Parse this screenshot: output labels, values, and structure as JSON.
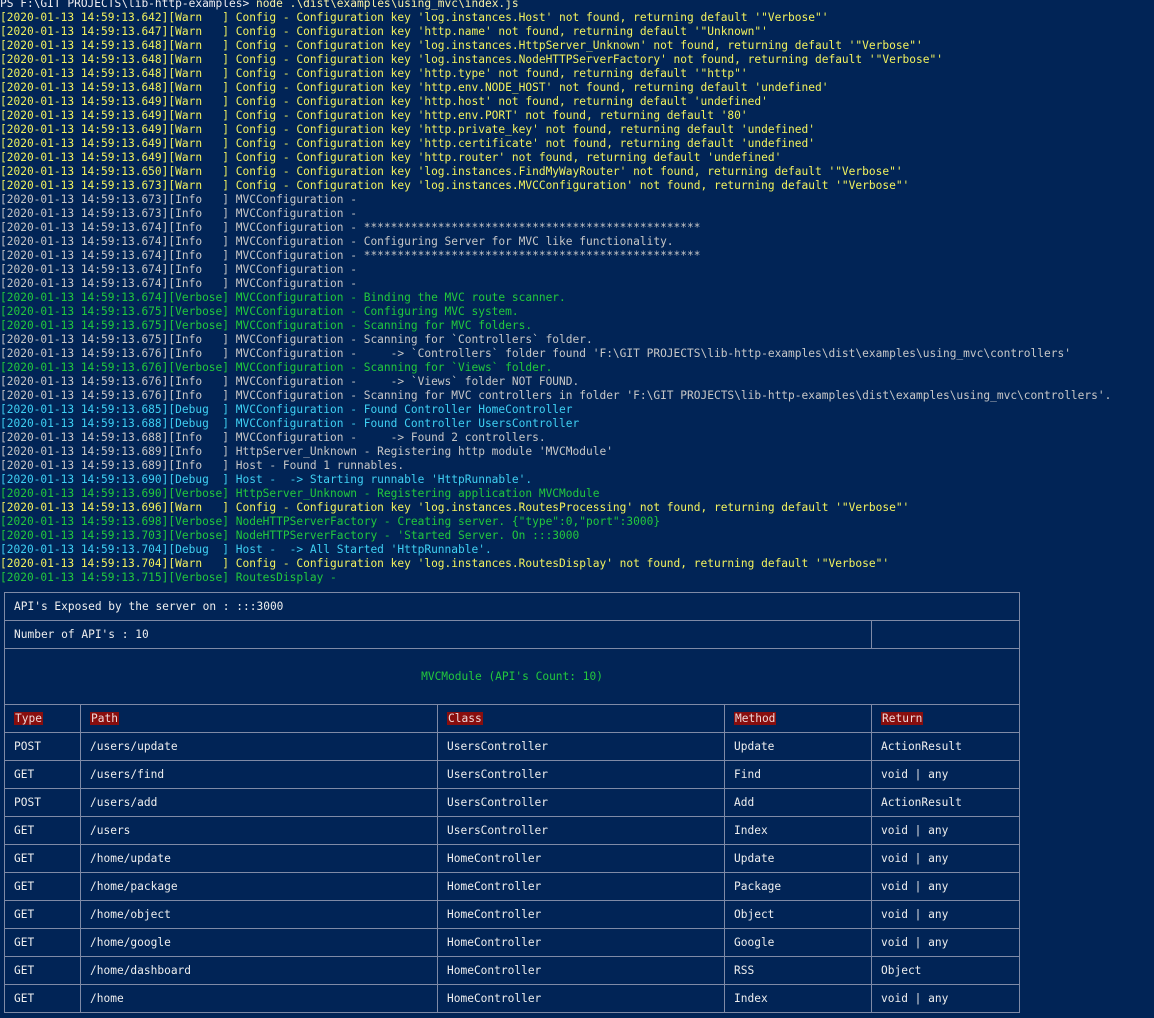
{
  "prompt": {
    "path": "PS F:\\GIT PROJECTS\\lib-http-examples> ",
    "command": "node .\\dist\\examples\\using_mvc\\index.js"
  },
  "log_lines": [
    {
      "level": "warn",
      "text": "[2020-01-13 14:59:13.642][Warn   ] Config - Configuration key 'log.instances.Host' not found, returning default '\"Verbose\"'"
    },
    {
      "level": "warn",
      "text": "[2020-01-13 14:59:13.647][Warn   ] Config - Configuration key 'http.name' not found, returning default '\"Unknown\"'"
    },
    {
      "level": "warn",
      "text": "[2020-01-13 14:59:13.648][Warn   ] Config - Configuration key 'log.instances.HttpServer_Unknown' not found, returning default '\"Verbose\"'"
    },
    {
      "level": "warn",
      "text": "[2020-01-13 14:59:13.648][Warn   ] Config - Configuration key 'log.instances.NodeHTTPServerFactory' not found, returning default '\"Verbose\"'"
    },
    {
      "level": "warn",
      "text": "[2020-01-13 14:59:13.648][Warn   ] Config - Configuration key 'http.type' not found, returning default '\"http\"'"
    },
    {
      "level": "warn",
      "text": "[2020-01-13 14:59:13.648][Warn   ] Config - Configuration key 'http.env.NODE_HOST' not found, returning default 'undefined'"
    },
    {
      "level": "warn",
      "text": "[2020-01-13 14:59:13.649][Warn   ] Config - Configuration key 'http.host' not found, returning default 'undefined'"
    },
    {
      "level": "warn",
      "text": "[2020-01-13 14:59:13.649][Warn   ] Config - Configuration key 'http.env.PORT' not found, returning default '80'"
    },
    {
      "level": "warn",
      "text": "[2020-01-13 14:59:13.649][Warn   ] Config - Configuration key 'http.private_key' not found, returning default 'undefined'"
    },
    {
      "level": "warn",
      "text": "[2020-01-13 14:59:13.649][Warn   ] Config - Configuration key 'http.certificate' not found, returning default 'undefined'"
    },
    {
      "level": "warn",
      "text": "[2020-01-13 14:59:13.649][Warn   ] Config - Configuration key 'http.router' not found, returning default 'undefined'"
    },
    {
      "level": "warn",
      "text": "[2020-01-13 14:59:13.650][Warn   ] Config - Configuration key 'log.instances.FindMyWayRouter' not found, returning default '\"Verbose\"'"
    },
    {
      "level": "warn",
      "text": "[2020-01-13 14:59:13.673][Warn   ] Config - Configuration key 'log.instances.MVCConfiguration' not found, returning default '\"Verbose\"'"
    },
    {
      "level": "info",
      "text": "[2020-01-13 14:59:13.673][Info   ] MVCConfiguration -"
    },
    {
      "level": "info",
      "text": "[2020-01-13 14:59:13.673][Info   ] MVCConfiguration -"
    },
    {
      "level": "info",
      "text": "[2020-01-13 14:59:13.674][Info   ] MVCConfiguration - **************************************************"
    },
    {
      "level": "info",
      "text": "[2020-01-13 14:59:13.674][Info   ] MVCConfiguration - Configuring Server for MVC like functionality."
    },
    {
      "level": "info",
      "text": "[2020-01-13 14:59:13.674][Info   ] MVCConfiguration - **************************************************"
    },
    {
      "level": "info",
      "text": "[2020-01-13 14:59:13.674][Info   ] MVCConfiguration -"
    },
    {
      "level": "info",
      "text": "[2020-01-13 14:59:13.674][Info   ] MVCConfiguration -"
    },
    {
      "level": "verbose",
      "text": "[2020-01-13 14:59:13.674][Verbose] MVCConfiguration - Binding the MVC route scanner."
    },
    {
      "level": "verbose",
      "text": "[2020-01-13 14:59:13.675][Verbose] MVCConfiguration - Configuring MVC system."
    },
    {
      "level": "verbose",
      "text": "[2020-01-13 14:59:13.675][Verbose] MVCConfiguration - Scanning for MVC folders."
    },
    {
      "level": "info",
      "text": "[2020-01-13 14:59:13.675][Info   ] MVCConfiguration - Scanning for `Controllers` folder."
    },
    {
      "level": "info",
      "text": "[2020-01-13 14:59:13.676][Info   ] MVCConfiguration -     -> `Controllers` folder found 'F:\\GIT PROJECTS\\lib-http-examples\\dist\\examples\\using_mvc\\controllers'"
    },
    {
      "level": "verbose",
      "text": "[2020-01-13 14:59:13.676][Verbose] MVCConfiguration - Scanning for `Views` folder."
    },
    {
      "level": "info",
      "text": "[2020-01-13 14:59:13.676][Info   ] MVCConfiguration -     -> `Views` folder NOT FOUND."
    },
    {
      "level": "info",
      "text": "[2020-01-13 14:59:13.676][Info   ] MVCConfiguration - Scanning for MVC controllers in folder 'F:\\GIT PROJECTS\\lib-http-examples\\dist\\examples\\using_mvc\\controllers'."
    },
    {
      "level": "debug",
      "text": "[2020-01-13 14:59:13.685][Debug  ] MVCConfiguration - Found Controller HomeController"
    },
    {
      "level": "debug",
      "text": "[2020-01-13 14:59:13.688][Debug  ] MVCConfiguration - Found Controller UsersController"
    },
    {
      "level": "info",
      "text": "[2020-01-13 14:59:13.688][Info   ] MVCConfiguration -     -> Found 2 controllers."
    },
    {
      "level": "info",
      "text": "[2020-01-13 14:59:13.689][Info   ] HttpServer_Unknown - Registering http module 'MVCModule'"
    },
    {
      "level": "info",
      "text": "[2020-01-13 14:59:13.689][Info   ] Host - Found 1 runnables."
    },
    {
      "level": "debug",
      "text": "[2020-01-13 14:59:13.690][Debug  ] Host -  -> Starting runnable 'HttpRunnable'."
    },
    {
      "level": "verbose",
      "text": "[2020-01-13 14:59:13.690][Verbose] HttpServer_Unknown - Registering application MVCModule"
    },
    {
      "level": "warn",
      "text": "[2020-01-13 14:59:13.696][Warn   ] Config - Configuration key 'log.instances.RoutesProcessing' not found, returning default '\"Verbose\"'"
    },
    {
      "level": "verbose",
      "text": "[2020-01-13 14:59:13.698][Verbose] NodeHTTPServerFactory - Creating server. {\"type\":0,\"port\":3000}"
    },
    {
      "level": "verbose",
      "text": "[2020-01-13 14:59:13.703][Verbose] NodeHTTPServerFactory - 'Started Server. On :::3000"
    },
    {
      "level": "debug",
      "text": "[2020-01-13 14:59:13.704][Debug  ] Host -  -> All Started 'HttpRunnable'."
    },
    {
      "level": "warn",
      "text": "[2020-01-13 14:59:13.704][Warn   ] Config - Configuration key 'log.instances.RoutesDisplay' not found, returning default '\"Verbose\"'"
    },
    {
      "level": "verbose",
      "text": "[2020-01-13 14:59:13.715][Verbose] RoutesDisplay -"
    }
  ],
  "api_table": {
    "exposed_text": "API's Exposed by the server on : :::3000",
    "count_text": "Number of API's : 10",
    "module_text": "MVCModule (API's Count: 10)",
    "headers": [
      "Type",
      "Path",
      "Class",
      "Method",
      "Return"
    ],
    "rows": [
      [
        "POST",
        "/users/update",
        "UsersController",
        "Update",
        "ActionResult"
      ],
      [
        "GET",
        "/users/find",
        "UsersController",
        "Find",
        "void | any"
      ],
      [
        "POST",
        "/users/add",
        "UsersController",
        "Add",
        "ActionResult"
      ],
      [
        "GET",
        "/users",
        "UsersController",
        "Index",
        "void | any"
      ],
      [
        "GET",
        "/home/update",
        "HomeController",
        "Update",
        "void | any"
      ],
      [
        "GET",
        "/home/package",
        "HomeController",
        "Package",
        "void | any"
      ],
      [
        "GET",
        "/home/object",
        "HomeController",
        "Object",
        "void | any"
      ],
      [
        "GET",
        "/home/google",
        "HomeController",
        "Google",
        "void | any"
      ],
      [
        "GET",
        "/home/dashboard",
        "HomeController",
        "RSS",
        "Object"
      ],
      [
        "GET",
        "/home",
        "HomeController",
        "Index",
        "void | any"
      ]
    ]
  },
  "colors": {
    "background": "#012456",
    "warn": "#f2f25e",
    "info": "#c7c7c7",
    "verbose": "#23c83d",
    "debug": "#3fd0f3",
    "header_bg": "#880e0e"
  }
}
